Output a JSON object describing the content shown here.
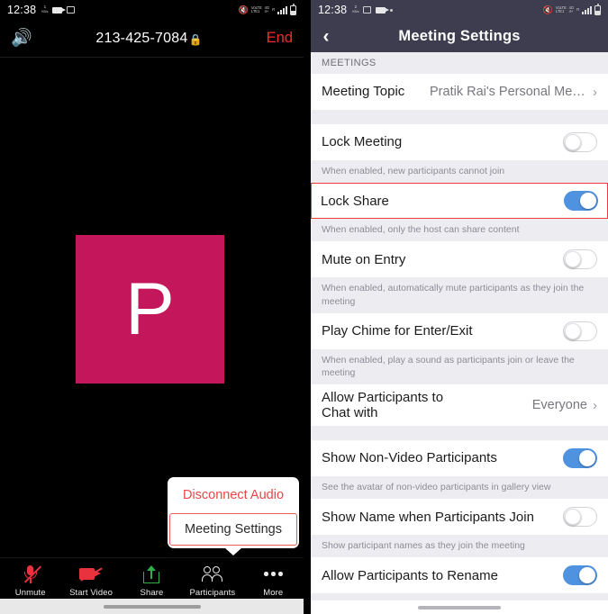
{
  "left": {
    "statusbar": {
      "time": "12:38",
      "kb_rate": "1",
      "kb_unit": "KB/s",
      "icons_left": [
        "camera-icon",
        "photo-icon"
      ],
      "icons_right": [
        "mute-icon",
        "volte-icon",
        "4g-icon",
        "roaming-icon",
        "signal-bars-icon",
        "battery-icon"
      ],
      "volte_top": "VoLTE",
      "volte_bottom": "LTE1",
      "net_top": "4G",
      "net_bottom": "4+",
      "roam_top": "R",
      "roam_bottom": ""
    },
    "call_bar": {
      "speaker_icon": "speaker-icon",
      "number": "213-425-7084",
      "lock_icon": "lock-icon",
      "end_label": "End"
    },
    "video": {
      "avatar_letter": "P",
      "avatar_color": "#c4175b"
    },
    "popup": {
      "items": [
        {
          "label": "Disconnect Audio",
          "style": "danger",
          "highlighted": false
        },
        {
          "label": "Meeting Settings",
          "style": "normal",
          "highlighted": true
        }
      ]
    },
    "toolbar": {
      "items": [
        {
          "label": "Unmute",
          "icon": "mic-muted-icon"
        },
        {
          "label": "Start Video",
          "icon": "camera-off-icon"
        },
        {
          "label": "Share",
          "icon": "share-up-arrow-icon"
        },
        {
          "label": "Participants",
          "icon": "participants-icon"
        },
        {
          "label": "More",
          "icon": "more-dots-icon"
        }
      ]
    }
  },
  "right": {
    "statusbar": {
      "time": "12:38",
      "kb_rate": "2",
      "kb_unit": "KB/s",
      "volte_top": "VoLTE",
      "volte_bottom": "LTE1",
      "net_top": "4G",
      "net_bottom": "4+",
      "roam_top": "R"
    },
    "header": {
      "back_icon": "back-chevron-icon",
      "title": "Meeting Settings"
    },
    "section_header": "MEETINGS",
    "rows": [
      {
        "type": "value",
        "label": "Meeting Topic",
        "value": "Pratik Rai's Personal Meeti...",
        "chevron": "chevron-right-icon",
        "name": "meeting-topic-row"
      },
      {
        "type": "gap"
      },
      {
        "type": "toggle",
        "label": "Lock Meeting",
        "state": "off",
        "hint": "When enabled, new participants cannot join",
        "highlighted": false,
        "name": "lock-meeting-row"
      },
      {
        "type": "toggle",
        "label": "Lock Share",
        "state": "on",
        "hint": "When enabled, only the host can share content",
        "highlighted": true,
        "name": "lock-share-row"
      },
      {
        "type": "toggle",
        "label": "Mute on Entry",
        "state": "off",
        "hint": "When enabled, automatically mute participants as they join the meeting",
        "highlighted": false,
        "name": "mute-on-entry-row"
      },
      {
        "type": "toggle",
        "label": "Play Chime for Enter/Exit",
        "state": "off",
        "hint": "When enabled, play a sound as participants join or leave the meeting",
        "highlighted": false,
        "name": "play-chime-row"
      },
      {
        "type": "value",
        "label": "Allow Participants to\nChat with",
        "value": "Everyone",
        "chevron": "chevron-right-icon",
        "name": "allow-chat-with-row"
      },
      {
        "type": "gap"
      },
      {
        "type": "toggle",
        "label": "Show Non-Video Participants",
        "state": "on",
        "hint": "See the avatar of non-video participants in gallery view",
        "highlighted": false,
        "name": "show-non-video-row"
      },
      {
        "type": "toggle",
        "label": "Show Name when Participants Join",
        "state": "off",
        "hint": "Show participant names as they join the meeting",
        "highlighted": false,
        "name": "show-name-row"
      },
      {
        "type": "toggle",
        "label": "Allow Participants to Rename",
        "state": "on",
        "hint": "",
        "highlighted": false,
        "name": "allow-rename-row"
      }
    ],
    "colors": {
      "toggle_on": "#4f92e0",
      "highlight": "#ef3b3b",
      "header_bg": "#3d3d4f",
      "hint_bg": "#ededf1"
    }
  }
}
